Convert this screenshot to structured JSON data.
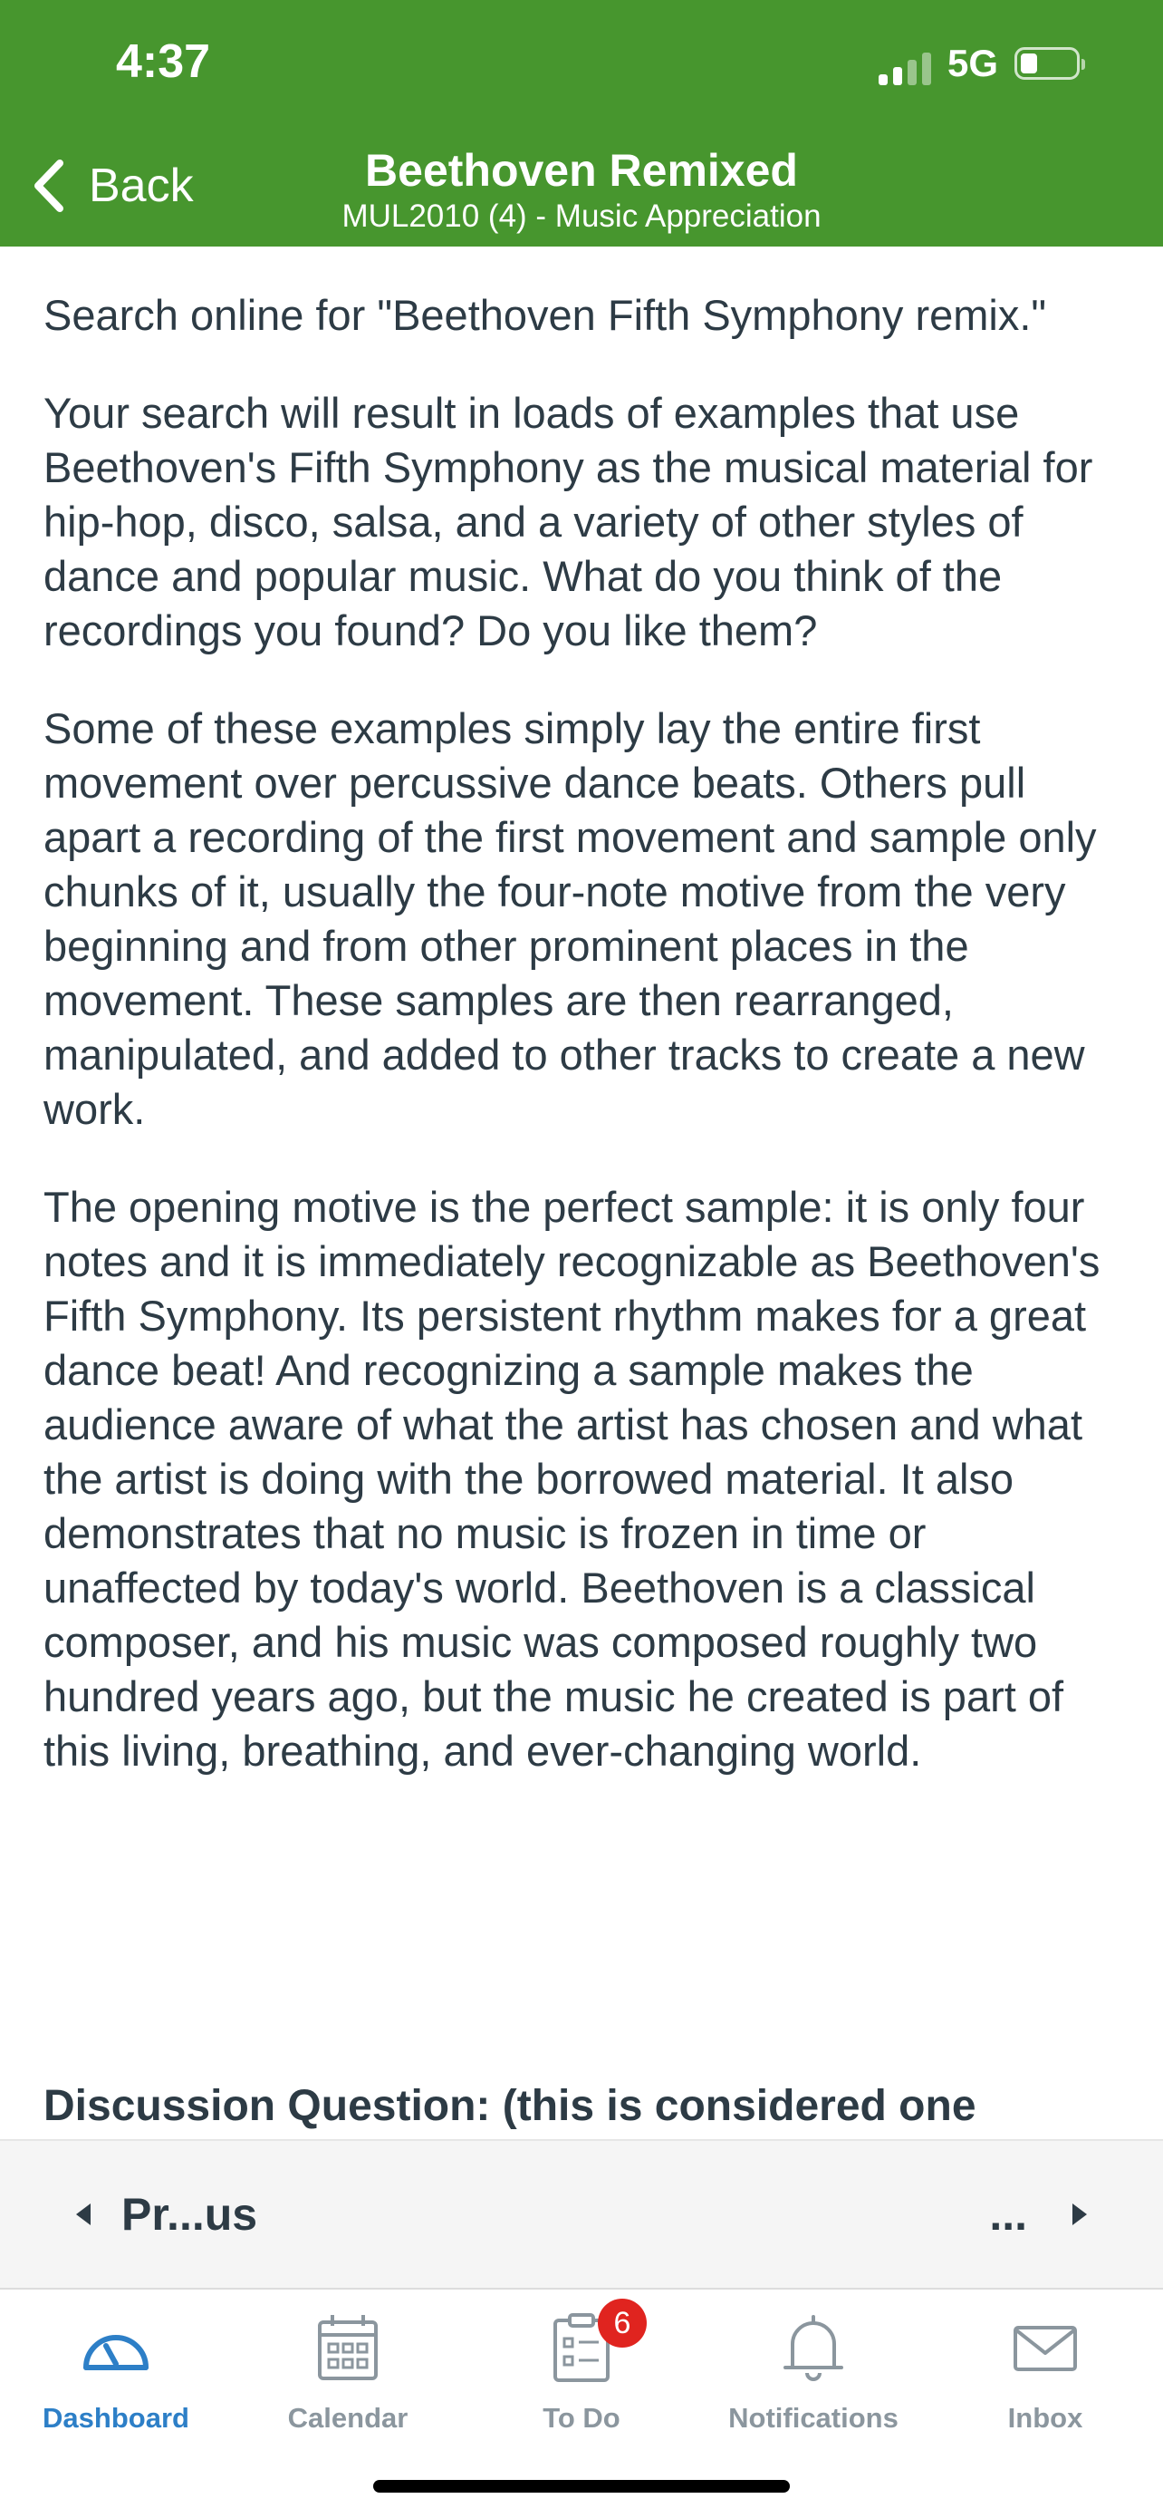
{
  "status_bar": {
    "time": "4:37",
    "network": "5G"
  },
  "header": {
    "back_label": "Back",
    "title": "Beethoven Remixed",
    "subtitle": "MUL2010 (4) - Music Appreciation",
    "color": "#47962e"
  },
  "content": {
    "paragraphs": [
      "Search online for \"Beethoven Fifth Symphony remix.\"",
      "Your search will result in loads of examples that use Beethoven's Fifth Symphony as the musical material for hip-hop, disco, salsa, and a variety of other styles of dance and popular music. What do you think of the recordings you found? Do you like them?",
      "Some of these examples simply lay the entire first movement over percussive dance beats. Others pull apart a recording of the first movement and sample only chunks of it, usually the four-note motive from the very beginning and from other prominent places in the movement. These samples are then rearranged, manipulated, and added to other tracks to create a new work.",
      "The opening motive is the perfect sample: it is only four notes and it is immediately recognizable as Beethoven's Fifth Symphony. Its persistent rhythm makes for a great dance beat! And recognizing a sample makes the audience aware of what the artist has chosen and what the artist is doing with the borrowed material. It also demonstrates that no music is frozen in time or unaffected by today's world. Beethoven is a classical composer, and his music was composed roughly two hundred years ago, but the music he created is part of this living, breathing, and ever-changing world."
    ],
    "discussion_heading": "Discussion Question: (this is considered one"
  },
  "pager": {
    "previous_label": "Pr...us",
    "next_label": "..."
  },
  "tabs": [
    {
      "label": "Dashboard",
      "icon": "dashboard-icon",
      "active": true
    },
    {
      "label": "Calendar",
      "icon": "calendar-icon",
      "active": false
    },
    {
      "label": "To Do",
      "icon": "todo-icon",
      "active": false,
      "badge": "6"
    },
    {
      "label": "Notifications",
      "icon": "bell-icon",
      "active": false
    },
    {
      "label": "Inbox",
      "icon": "mail-icon",
      "active": false
    }
  ],
  "colors": {
    "accent": "#2d7fc7",
    "inactive": "#8b969e",
    "badge": "#e0241f"
  }
}
